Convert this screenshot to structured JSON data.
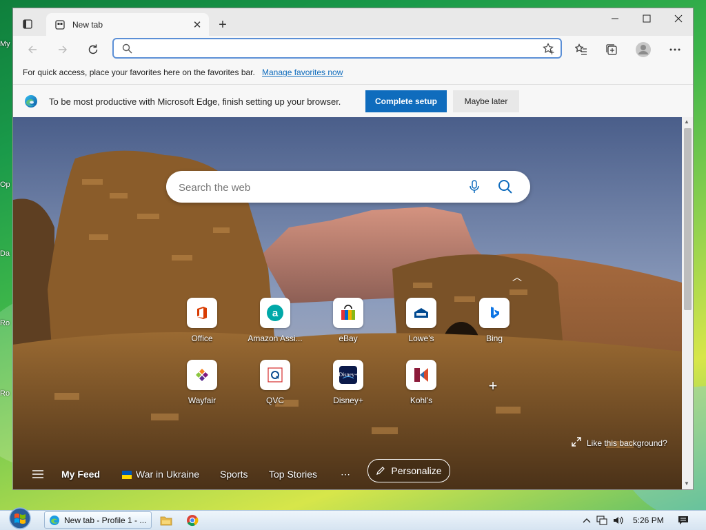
{
  "desktop": {
    "icon_labels": [
      "My",
      "Op",
      "Da",
      "Ro",
      "Ro"
    ]
  },
  "browser": {
    "tab": {
      "title": "New tab"
    },
    "address": {
      "value": "",
      "placeholder": ""
    },
    "favorites_bar": {
      "message": "For quick access, place your favorites here on the favorites bar.",
      "link": "Manage favorites now"
    },
    "setup_bar": {
      "message": "To be most productive with Microsoft Edge, finish setting up your browser.",
      "primary": "Complete setup",
      "secondary": "Maybe later"
    }
  },
  "newtab": {
    "search_placeholder": "Search the web",
    "tiles": [
      {
        "label": "Office",
        "icon": "office-icon",
        "color": "#d83b01"
      },
      {
        "label": "Amazon Assi...",
        "icon": "amazon-icon",
        "color": "#00a8a8"
      },
      {
        "label": "eBay",
        "icon": "ebay-icon",
        "color": "#e53238"
      },
      {
        "label": "Lowe's",
        "icon": "lowes-icon",
        "color": "#004990"
      },
      {
        "label": "Bing",
        "icon": "bing-icon",
        "color": "#0c74e4"
      },
      {
        "label": "Wayfair",
        "icon": "wayfair-icon",
        "color": "#7f187f"
      },
      {
        "label": "QVC",
        "icon": "qvc-icon",
        "color": "#d62b2b"
      },
      {
        "label": "Disney+",
        "icon": "disney-plus-icon",
        "color": "#0b1a4a"
      },
      {
        "label": "Kohl's",
        "icon": "kohls-icon",
        "color": "#8b1a3a"
      }
    ],
    "like_background": "Like this background?",
    "feed": {
      "my_feed": "My Feed",
      "war": "War in Ukraine",
      "sports": "Sports",
      "top_stories": "Top Stories",
      "more": "⋯",
      "personalize": "Personalize"
    }
  },
  "taskbar": {
    "active_item": "New tab - Profile 1 - ...",
    "clock": "5:26 PM"
  },
  "colors": {
    "accent": "#0f6cbd",
    "address_border": "#5b8fd6"
  }
}
